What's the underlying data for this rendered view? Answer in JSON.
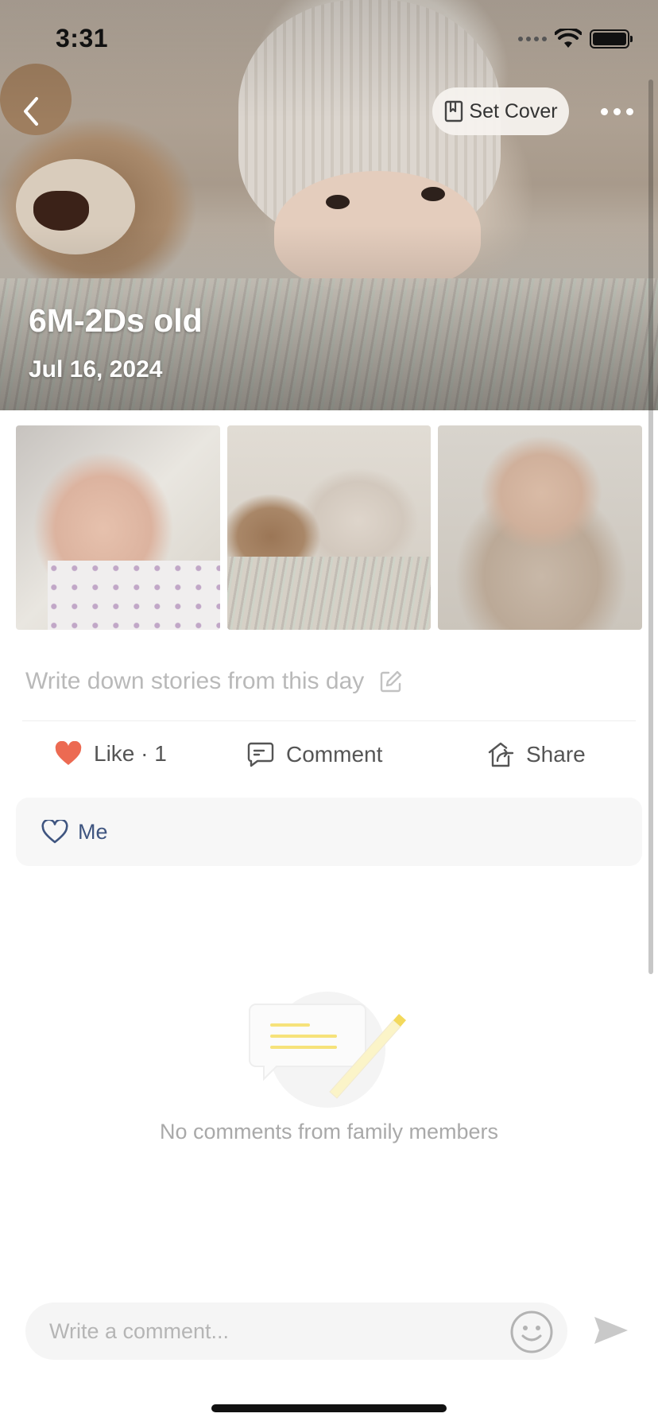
{
  "status_bar": {
    "time": "3:31"
  },
  "header": {
    "set_cover_label": "Set Cover",
    "title": "6M-2Ds old",
    "date": "Jul 16, 2024"
  },
  "story": {
    "placeholder": "Write down stories from this day"
  },
  "actions": {
    "like_label": "Like · 1",
    "comment_label": "Comment",
    "share_label": "Share"
  },
  "likes": {
    "names": [
      "Me"
    ]
  },
  "empty_state": {
    "text": "No comments from family members"
  },
  "comment_box": {
    "placeholder": "Write a comment..."
  },
  "colors": {
    "like_heart": "#ec6a52",
    "likes_name": "#3f5580",
    "placeholder_gray": "#b9b9b9"
  },
  "icons": [
    "chevron-left-icon",
    "bookmark-icon",
    "ellipsis-icon",
    "pencil-edit-icon",
    "heart-filled-icon",
    "chat-bubble-icon",
    "share-house-icon",
    "heart-outline-icon",
    "smiley-icon",
    "send-icon",
    "wifi-icon",
    "battery-icon"
  ]
}
